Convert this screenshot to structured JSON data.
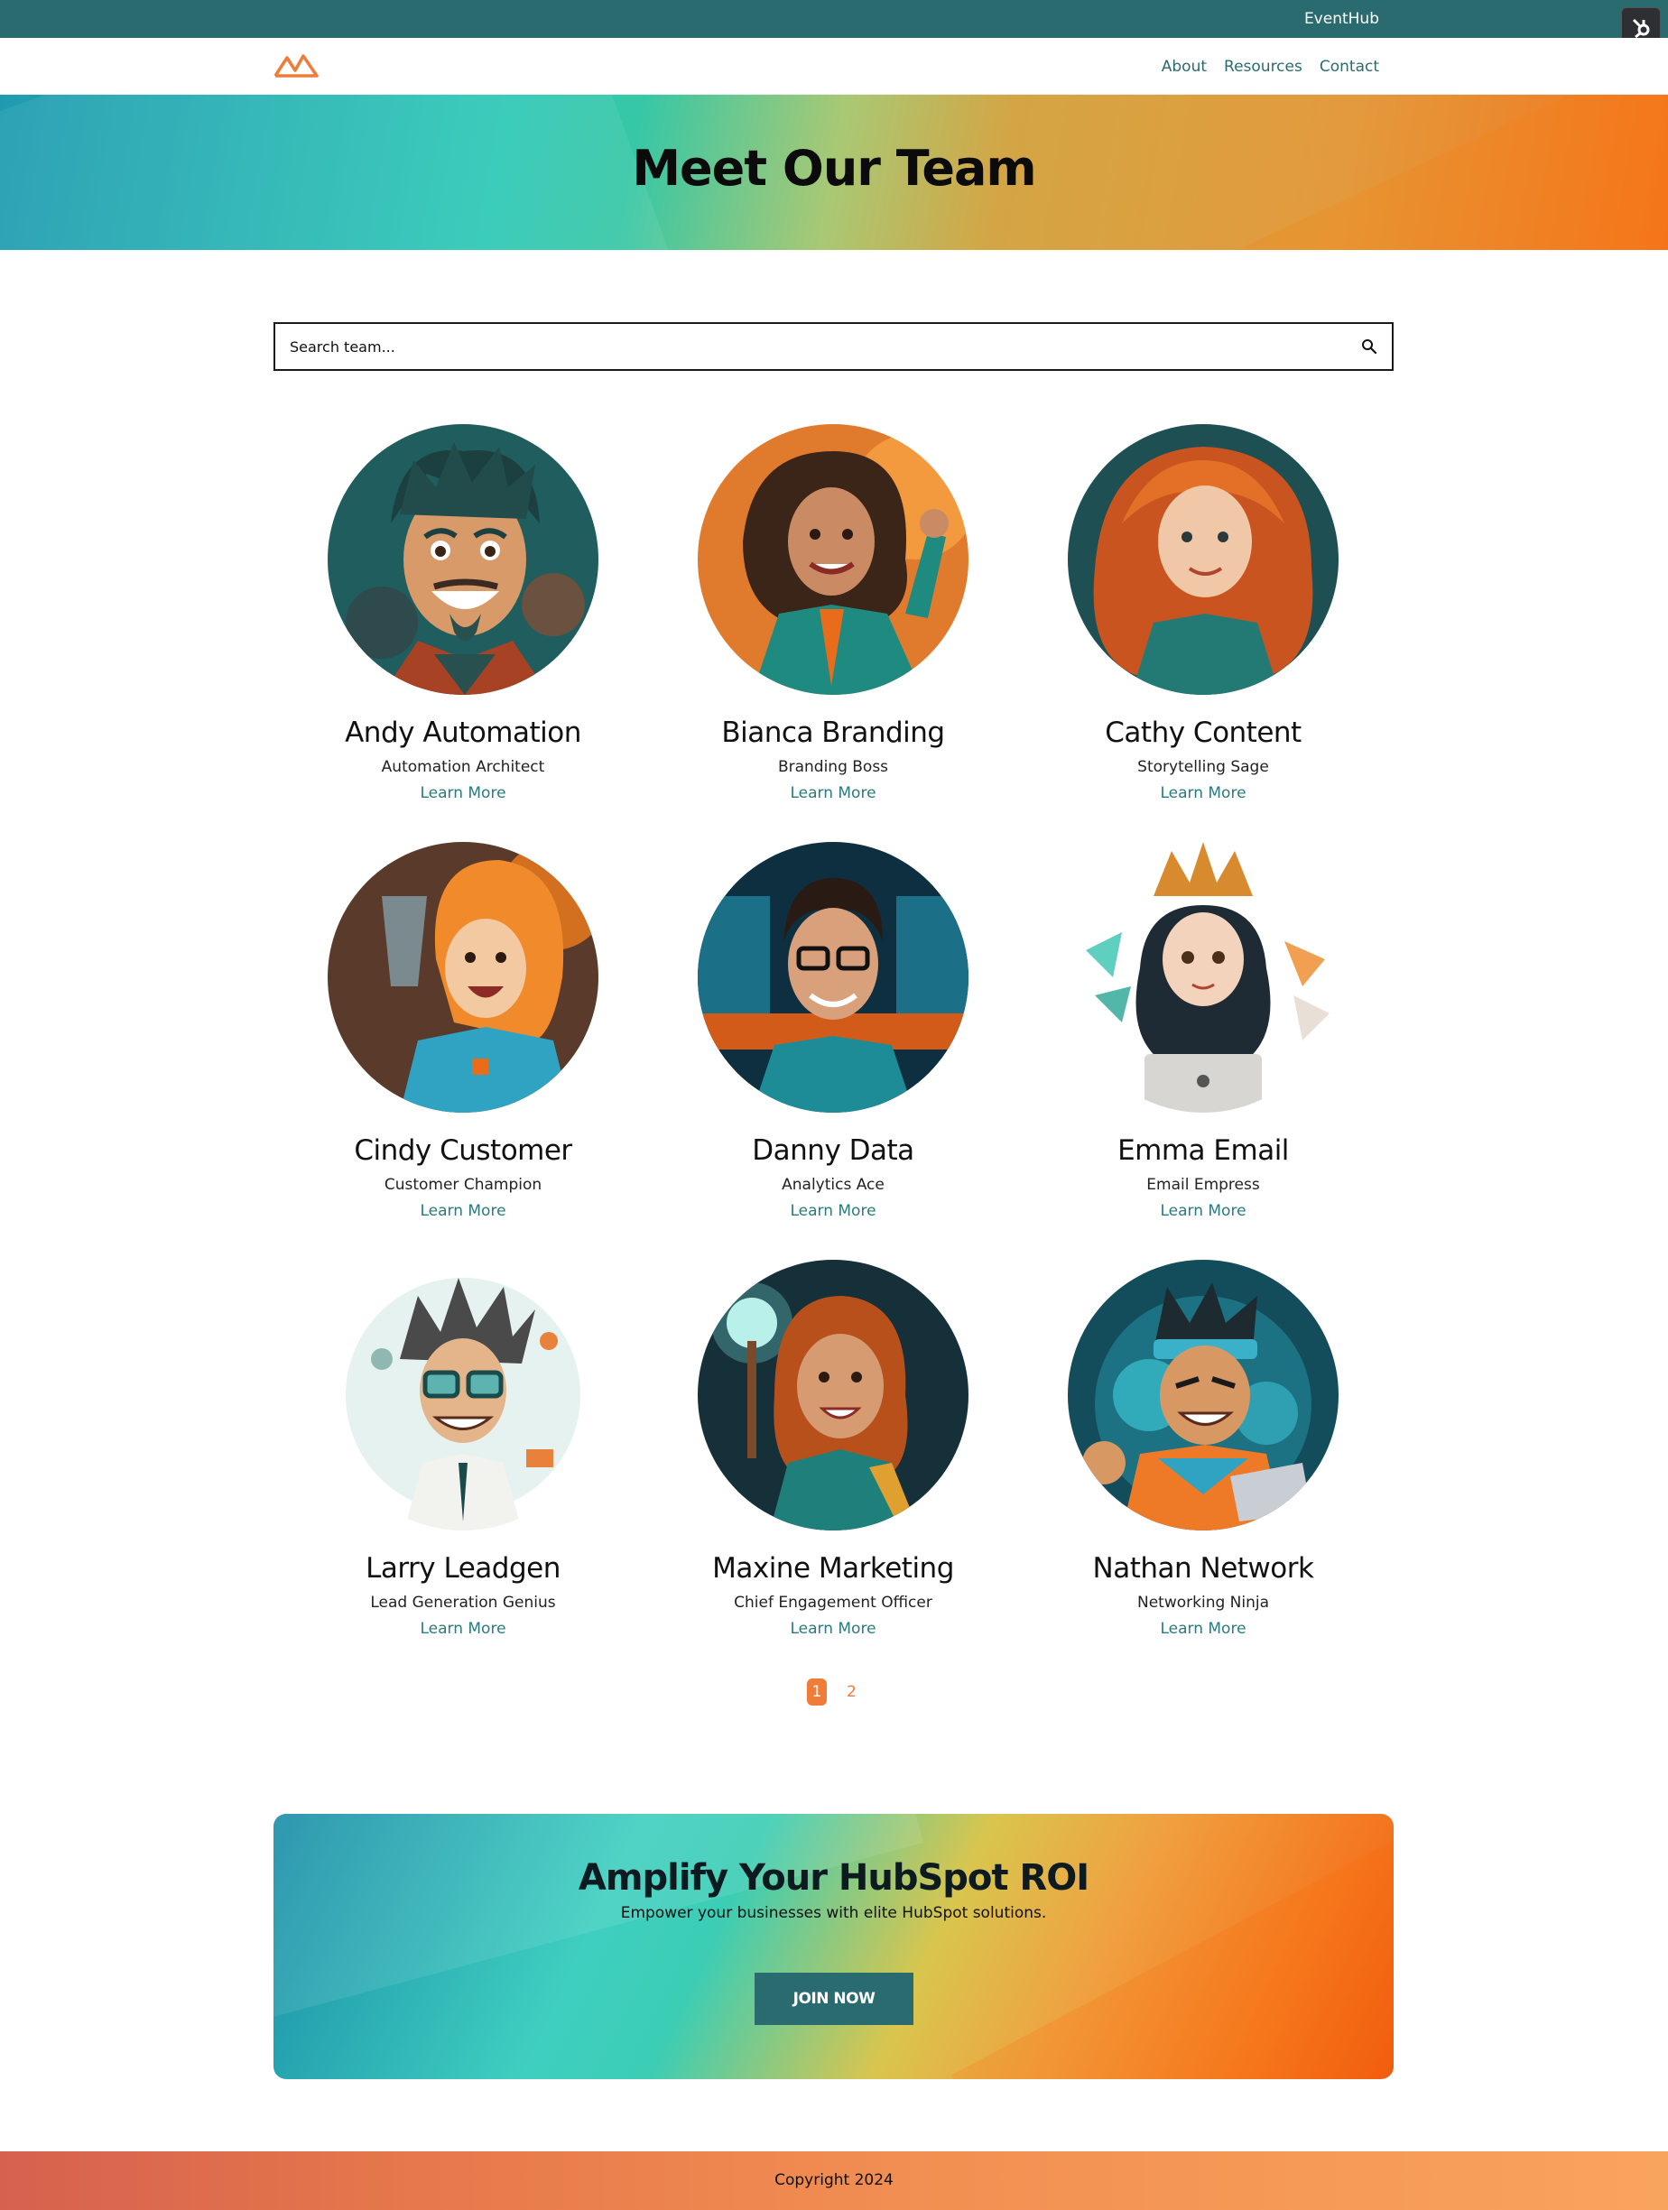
{
  "topbar": {
    "link_label": "EventHub"
  },
  "nav": {
    "items": [
      "About",
      "Resources",
      "Contact"
    ]
  },
  "hero": {
    "title": "Meet Our Team"
  },
  "search": {
    "placeholder": "Search team..."
  },
  "team": [
    {
      "name": "Andy Automation",
      "role": "Automation Architect",
      "link": "Learn More"
    },
    {
      "name": "Bianca Branding",
      "role": "Branding Boss",
      "link": "Learn More"
    },
    {
      "name": "Cathy Content",
      "role": "Storytelling Sage",
      "link": "Learn More"
    },
    {
      "name": "Cindy Customer",
      "role": "Customer Champion",
      "link": "Learn More"
    },
    {
      "name": "Danny Data",
      "role": "Analytics Ace",
      "link": "Learn More"
    },
    {
      "name": "Emma Email",
      "role": "Email Empress",
      "link": "Learn More"
    },
    {
      "name": "Larry Leadgen",
      "role": "Lead Generation Genius",
      "link": "Learn More"
    },
    {
      "name": "Maxine Marketing",
      "role": "Chief Engagement Officer",
      "link": "Learn More"
    },
    {
      "name": "Nathan Network",
      "role": "Networking Ninja",
      "link": "Learn More"
    }
  ],
  "pagination": {
    "pages": [
      "1",
      "2"
    ],
    "current": "1"
  },
  "cta": {
    "title": "Amplify Your HubSpot ROI",
    "subtitle": "Empower your businesses with elite HubSpot solutions.",
    "button_label": "JOIN NOW"
  },
  "footer": {
    "copyright": "Copyright 2024"
  },
  "colors": {
    "accent_teal": "#2a6b70",
    "accent_orange": "#f07c3a",
    "link_teal": "#2a7b80"
  },
  "icons": {
    "logo": "mountain-logo-icon",
    "search": "search-icon",
    "hubspot": "hubspot-sprocket-icon"
  }
}
